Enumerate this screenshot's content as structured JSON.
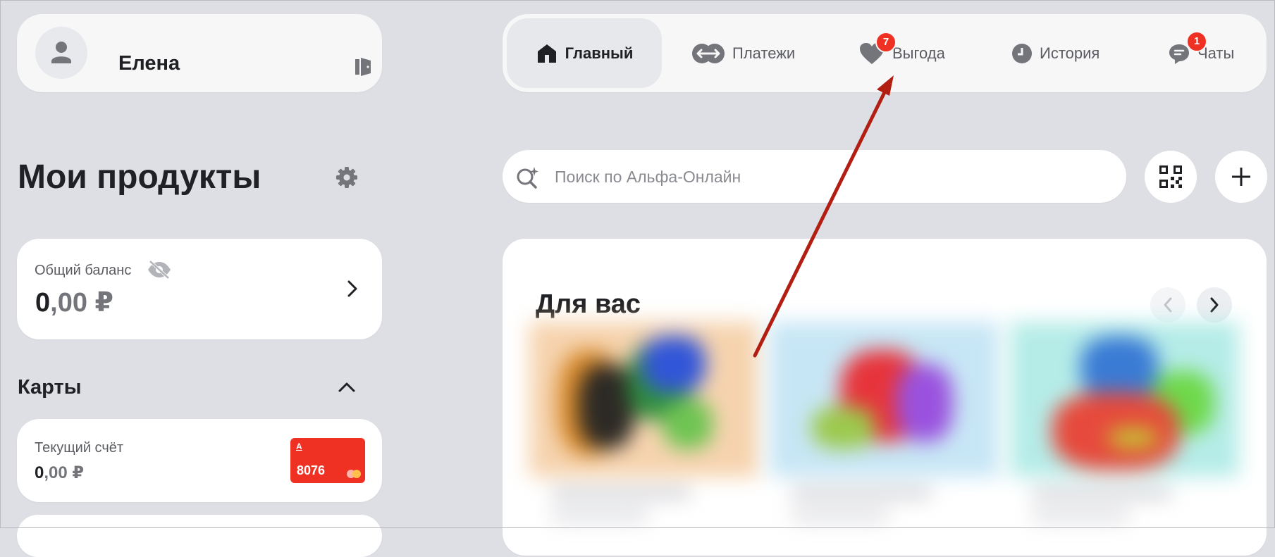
{
  "profile": {
    "name": "Елена",
    "avatar_icon": "user-icon",
    "logout_icon": "logout-icon"
  },
  "nav": {
    "tabs": [
      {
        "label": "Главный",
        "icon": "home-icon",
        "active": true
      },
      {
        "label": "Платежи",
        "icon": "transfer-icon"
      },
      {
        "label": "Выгода",
        "icon": "heart-icon",
        "badge": "7"
      },
      {
        "label": "История",
        "icon": "clock-icon"
      },
      {
        "label": "Чаты",
        "icon": "chat-icon",
        "badge": "1"
      }
    ]
  },
  "products": {
    "title": "Мои продукты",
    "balance": {
      "label": "Общий баланс",
      "integer": "0",
      "decimal": ",00",
      "currency": "₽"
    },
    "cards_title": "Карты",
    "accounts": [
      {
        "name": "Текущий счёт",
        "integer": "0",
        "decimal": ",00",
        "currency": "₽",
        "card_brand": "A",
        "card_number": "8076"
      }
    ]
  },
  "search": {
    "placeholder": "Поиск по Альфа-Онлайн"
  },
  "foryou": {
    "title": "Для вас"
  },
  "colors": {
    "accent": "#ef3124",
    "background": "#dedfe4",
    "annotation_arrow": "#b21e12"
  }
}
